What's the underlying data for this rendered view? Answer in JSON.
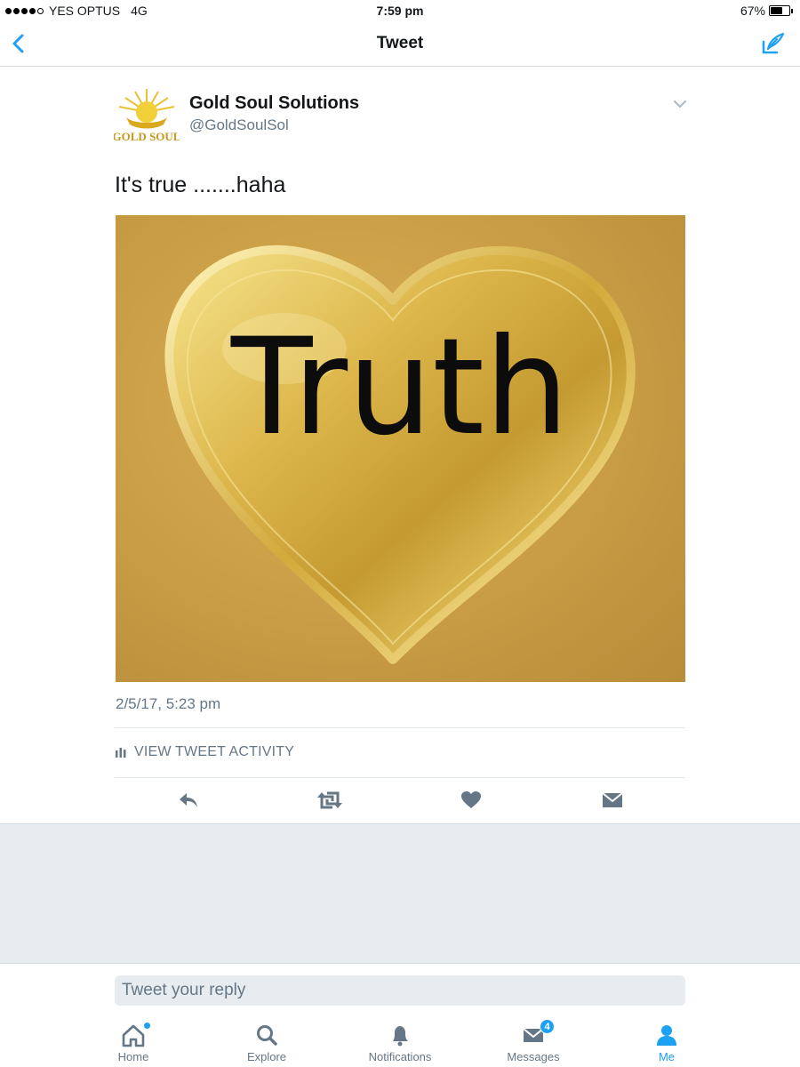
{
  "status_bar": {
    "carrier": "YES OPTUS",
    "network": "4G",
    "time": "7:59 pm",
    "battery_percent": "67%",
    "battery_level": 0.67,
    "signal_bars_filled": 4,
    "signal_bars_total": 5
  },
  "nav": {
    "title": "Tweet",
    "back_icon": "chevron-left-icon",
    "compose_icon": "compose-icon"
  },
  "tweet": {
    "author_name": "Gold Soul Solutions",
    "author_handle": "@GoldSoulSol",
    "avatar_logo_text": "GOLD SOUL",
    "text": "It's true .......haha",
    "media_text": "Truth",
    "timestamp": "2/5/17, 5:23 pm",
    "activity_label": "VIEW TWEET ACTIVITY"
  },
  "actions": [
    "reply-icon",
    "retweet-icon",
    "like-icon",
    "direct-message-icon"
  ],
  "reply": {
    "placeholder": "Tweet your reply"
  },
  "tabs": [
    {
      "label": "Home",
      "icon": "home-icon",
      "active": false,
      "dot": true
    },
    {
      "label": "Explore",
      "icon": "search-icon",
      "active": false
    },
    {
      "label": "Notifications",
      "icon": "bell-icon",
      "active": false
    },
    {
      "label": "Messages",
      "icon": "envelope-icon",
      "active": false,
      "badge": "4"
    },
    {
      "label": "Me",
      "icon": "person-icon",
      "active": true
    }
  ],
  "colors": {
    "accent": "#1da1f2",
    "muted": "#657786",
    "divider": "#e1e8ed",
    "gold": "#c99d45"
  }
}
